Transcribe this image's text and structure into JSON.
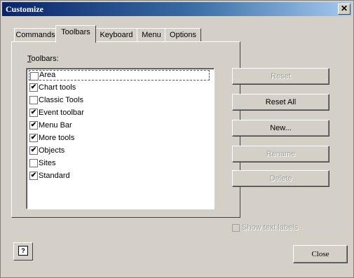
{
  "window": {
    "title": "Customize",
    "close_glyph": "✕"
  },
  "tabs": [
    {
      "label": "Commands"
    },
    {
      "label": "Toolbars"
    },
    {
      "label": "Keyboard"
    },
    {
      "label": "Menu"
    },
    {
      "label": "Options"
    }
  ],
  "active_tab": "Toolbars",
  "toolbars_list": {
    "label_prefix": "T",
    "label_rest": "oolbars:",
    "items": [
      {
        "label": "Area",
        "checked": false,
        "mark": ""
      },
      {
        "label": "Chart tools",
        "checked": true,
        "mark": "✔"
      },
      {
        "label": "Classic Tools",
        "checked": false,
        "mark": ""
      },
      {
        "label": "Event toolbar",
        "checked": true,
        "mark": "✔"
      },
      {
        "label": "Menu Bar",
        "checked": true,
        "mark": "✔"
      },
      {
        "label": "More tools",
        "checked": true,
        "mark": "✔"
      },
      {
        "label": "Objects",
        "checked": true,
        "mark": "✔"
      },
      {
        "label": "Sites",
        "checked": false,
        "mark": ""
      },
      {
        "label": "Standard",
        "checked": true,
        "mark": "✔"
      }
    ]
  },
  "buttons": {
    "reset": "Reset",
    "reset_all": "Reset All",
    "new": "New...",
    "rename": "Rename",
    "delete": "Delete",
    "close": "Close"
  },
  "show_text_labels": {
    "label": "Show text labels",
    "enabled": false
  },
  "help_glyph": "?"
}
